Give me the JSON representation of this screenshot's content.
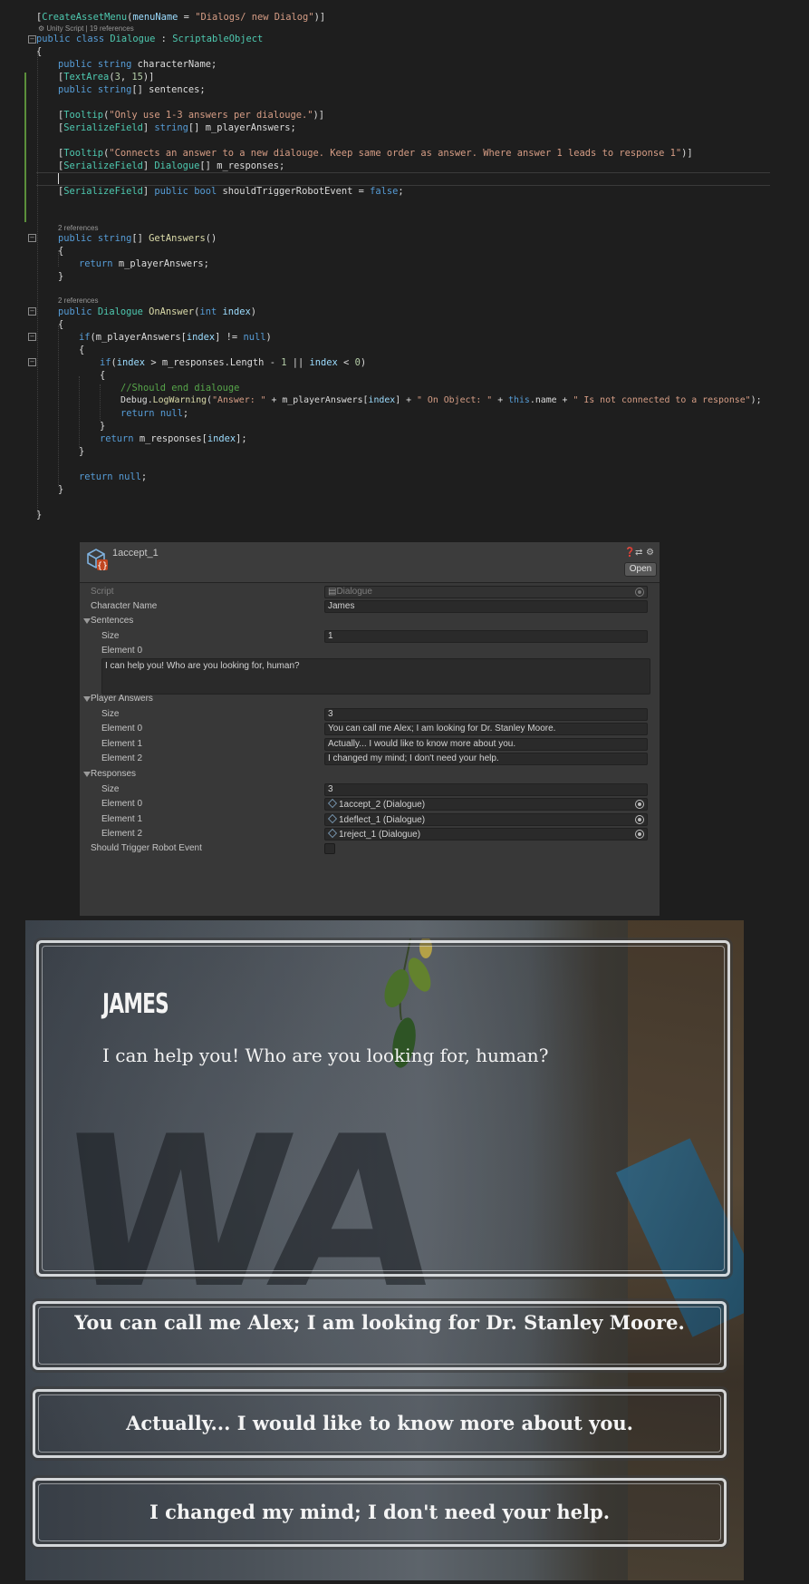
{
  "code": {
    "attr_open": "[",
    "create_asset_menu": "CreateAssetMenu",
    "menu_name_param": "menuName",
    "eq": " = ",
    "menu_name_value": "\"Dialogs/ new Dialog\"",
    "attr_close": ")]",
    "codelens_class": "Unity Script | 19 references",
    "kw_public": "public",
    "kw_class": "class",
    "class_name": "Dialogue",
    "base_class": "ScriptableObject",
    "kw_string": "string",
    "field_character": "characterName;",
    "textarea_attr": "TextArea",
    "textarea_a": "3",
    "textarea_b": "15",
    "kw_string_arr": "string",
    "field_sentences": "[] sentences;",
    "tooltip_attr": "Tooltip",
    "tooltip1": "\"Only use 1-3 answers per dialouge.\"",
    "serialize_attr": "SerializeField",
    "field_player_answers": "[] m_playerAnswers;",
    "tooltip2": "\"Connects an answer to a new dialouge. Keep same order as answer. Where answer 1 leads to response 1\"",
    "field_responses": "[] m_responses;",
    "kw_bool": "bool",
    "field_trigger": "shouldTriggerRobotEvent = ",
    "kw_false": "false",
    "codelens_refs": "2 references",
    "method_get_answers": "GetAnswers",
    "kw_return": "return",
    "ret_player_answers": "m_playerAnswers;",
    "method_on_answer": "OnAnswer",
    "kw_int": "int",
    "param_index": "index",
    "kw_if": "if",
    "if1": "(m_playerAnswers[",
    "if1_end": "] != ",
    "kw_null": "null",
    "if2_a": "(",
    "if2_b": " > m_responses.Length - ",
    "num_1": "1",
    "if2_c": " || ",
    "if2_d": " < ",
    "num_0": "0",
    "comment": "//Should end dialouge",
    "debug": "Debug.",
    "log_warning": "LogWarning",
    "str_answer": "\"Answer: \"",
    "plus_arr": " + m_playerAnswers[",
    "str_on_object": "\" On Object: \"",
    "kw_this": "this",
    "dot_name": ".name + ",
    "str_not_connected": "\" Is not connected to a response\"",
    "ret_responses": "m_responses[",
    "brace_open": "{",
    "brace_close": "}"
  },
  "inspector": {
    "asset_name": "1accept_1",
    "open_button": "Open",
    "help_icon": "help-icon",
    "settings_icon": "settings-icon",
    "script_label": "Script",
    "script_value": "Dialogue",
    "character_name_label": "Character Name",
    "character_name_value": "James",
    "sentences_label": "Sentences",
    "size_label": "Size",
    "sentences_size": "1",
    "element0_label": "Element 0",
    "element1_label": "Element 1",
    "element2_label": "Element 2",
    "sentence0": "I can help you! Who are you looking for, human?",
    "player_answers_label": "Player Answers",
    "answers_size": "3",
    "answer0": "You can call me Alex; I am looking for Dr. Stanley Moore.",
    "answer1": "Actually... I would like to know more about you.",
    "answer2": "I changed my mind; I don't need your help.",
    "responses_label": "Responses",
    "responses_size": "3",
    "response0": "1accept_2 (Dialogue)",
    "response1": "1deflect_1 (Dialogue)",
    "response2": "1reject_1 (Dialogue)",
    "trigger_label": "Should Trigger Robot Event"
  },
  "game": {
    "speaker": "JAMES",
    "line": "I can help you! Who are you looking for, human?",
    "answers": [
      "You can call me Alex; I am looking for Dr. Stanley Moore.",
      "Actually... I would like to know more about you.",
      "I changed my mind; I don't need your help."
    ]
  }
}
